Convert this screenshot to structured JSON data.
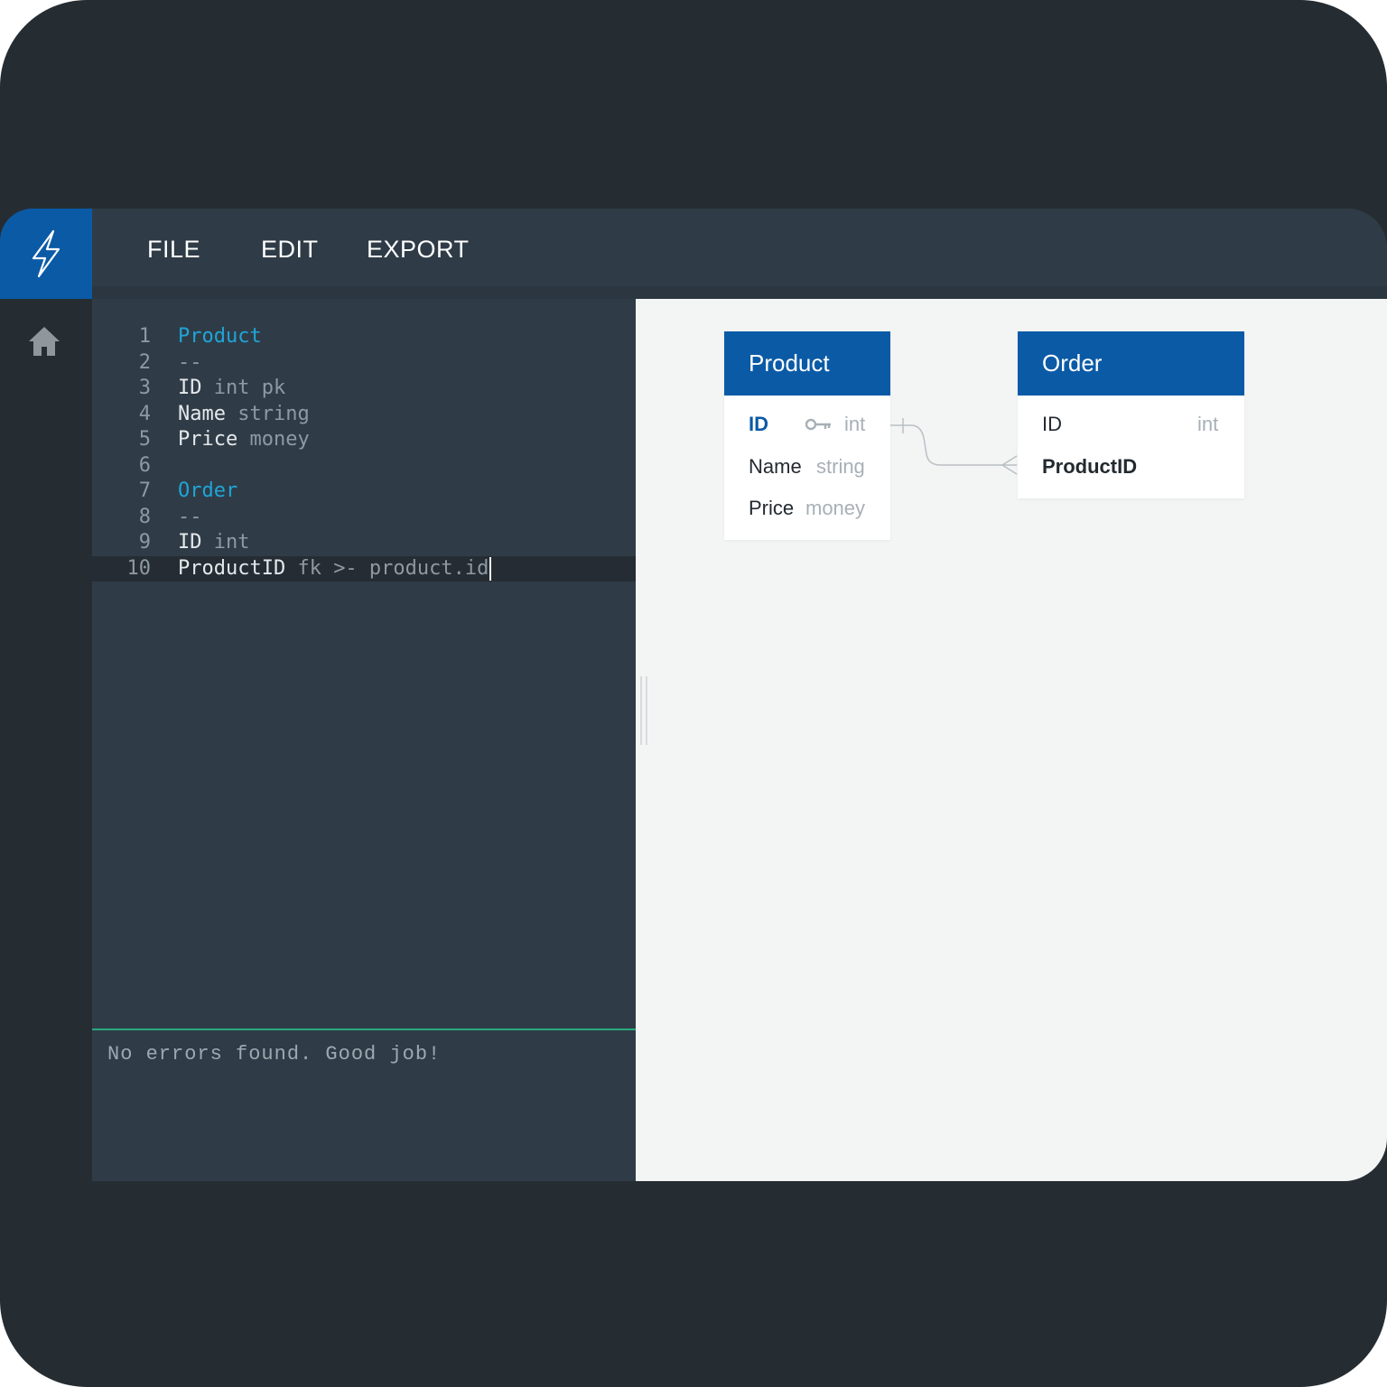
{
  "menu": {
    "file": "FILE",
    "edit": "EDIT",
    "export": "EXPORT"
  },
  "editor": {
    "lines": [
      {
        "n": "1",
        "tokens": [
          {
            "t": "Product",
            "c": "kw"
          }
        ]
      },
      {
        "n": "2",
        "tokens": [
          {
            "t": "--",
            "c": "dim"
          }
        ]
      },
      {
        "n": "3",
        "tokens": [
          {
            "t": "ID ",
            "c": "id"
          },
          {
            "t": "int pk",
            "c": "dim"
          }
        ]
      },
      {
        "n": "4",
        "tokens": [
          {
            "t": "Name ",
            "c": "id"
          },
          {
            "t": "string",
            "c": "dim"
          }
        ]
      },
      {
        "n": "5",
        "tokens": [
          {
            "t": "Price ",
            "c": "id"
          },
          {
            "t": "money",
            "c": "dim"
          }
        ]
      },
      {
        "n": "6",
        "tokens": []
      },
      {
        "n": "7",
        "tokens": [
          {
            "t": "Order",
            "c": "kw"
          }
        ]
      },
      {
        "n": "8",
        "tokens": [
          {
            "t": "--",
            "c": "dim"
          }
        ]
      },
      {
        "n": "9",
        "tokens": [
          {
            "t": "ID ",
            "c": "id"
          },
          {
            "t": "int",
            "c": "dim"
          }
        ]
      },
      {
        "n": "10",
        "tokens": [
          {
            "t": "ProductID ",
            "c": "id"
          },
          {
            "t": "fk >- product.id",
            "c": "dim"
          }
        ],
        "active": true
      }
    ],
    "status": "No errors found. Good job!"
  },
  "diagram": {
    "product": {
      "title": "Product",
      "fields": [
        {
          "name": "ID",
          "type": "int",
          "pk": true
        },
        {
          "name": "Name",
          "type": "string"
        },
        {
          "name": "Price",
          "type": "money"
        }
      ]
    },
    "order": {
      "title": "Order",
      "fields": [
        {
          "name": "ID",
          "type": "int"
        },
        {
          "name": "ProductID",
          "type": "",
          "fk": true
        }
      ]
    }
  },
  "icons": {
    "logo": "lightning-bolt-icon",
    "home": "home-icon",
    "key": "key-icon"
  },
  "colors": {
    "accent": "#0b5aa6",
    "keyword": "#1fa5d8",
    "status_line": "#2aaa7b",
    "background": "#262d32",
    "panel": "#2f3c47"
  }
}
